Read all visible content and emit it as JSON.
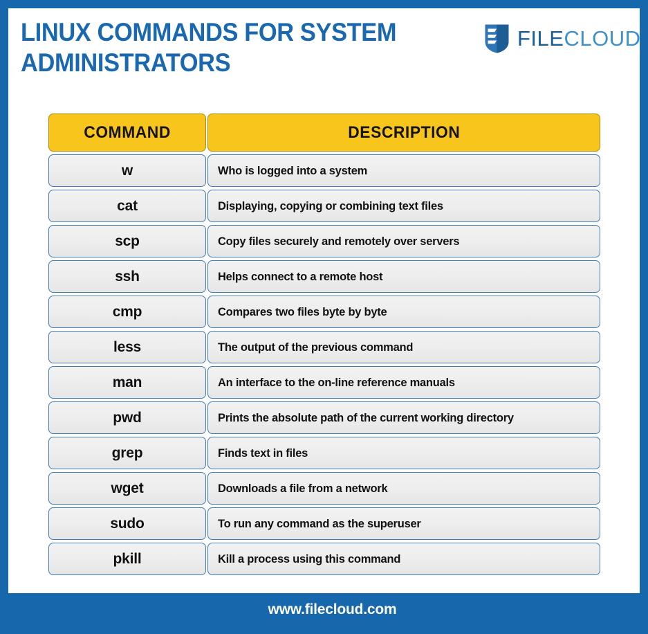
{
  "header": {
    "title": "Linux Commands for System Administrators",
    "logo": {
      "icon": "filecloud-shield-icon",
      "word_primary": "FILE",
      "word_secondary": "CLOUD"
    }
  },
  "table": {
    "columns": [
      "COMMAND",
      "DESCRIPTION"
    ],
    "rows": [
      {
        "command": "w",
        "description": "Who is logged into a system"
      },
      {
        "command": "cat",
        "description": "Displaying, copying or combining text files"
      },
      {
        "command": "scp",
        "description": "Copy files securely and remotely over servers"
      },
      {
        "command": "ssh",
        "description": "Helps connect to a remote host"
      },
      {
        "command": "cmp",
        "description": "Compares two files byte by byte"
      },
      {
        "command": "less",
        "description": "The output of the previous command"
      },
      {
        "command": "man",
        "description": "An interface to the on-line reference manuals"
      },
      {
        "command": "pwd",
        "description": "Prints the absolute path of the current working directory"
      },
      {
        "command": "grep",
        "description": "Finds text in files"
      },
      {
        "command": "wget",
        "description": "Downloads a file from a network"
      },
      {
        "command": "sudo",
        "description": "To run any command as the superuser"
      },
      {
        "command": "pkill",
        "description": "Kill a process using this command"
      }
    ]
  },
  "footer": {
    "website": "www.filecloud.com"
  },
  "colors": {
    "frame_blue": "#1767ad",
    "title_blue": "#1a69b0",
    "header_yellow": "#f7c51b",
    "cell_border_blue": "#3f7cb8",
    "row_gray": "#eeeeee",
    "logo_file_blue": "#1b5d96",
    "logo_cloud_blue": "#3f90c9"
  }
}
